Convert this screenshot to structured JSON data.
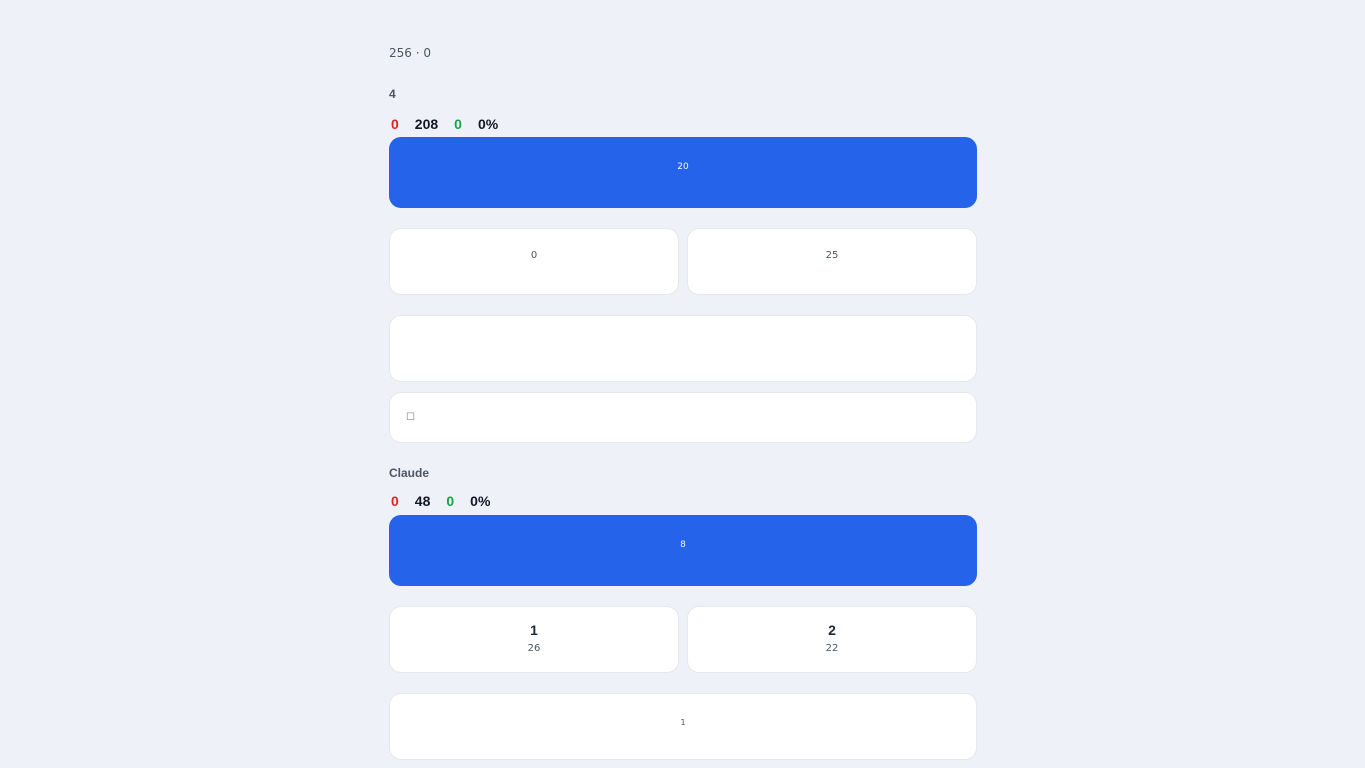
{
  "header": {
    "title": "",
    "subtitle": "256 · 0"
  },
  "section1": {
    "title_prefix": "",
    "title_count": "4",
    "stats": [
      {
        "value": "0",
        "label": "",
        "color": "#dc2626"
      },
      {
        "value": "208",
        "label": "",
        "color": "#111827"
      },
      {
        "value": "0",
        "label": "",
        "color": "#16a34a"
      },
      {
        "value": "0%",
        "label": "",
        "color": "#111827"
      }
    ],
    "primary": {
      "title": "",
      "subtitle": "20"
    },
    "cards": [
      {
        "title": "",
        "subtitle": "0"
      },
      {
        "title": "",
        "subtitle": "25"
      }
    ],
    "wide_card": {
      "title": "",
      "subtitle": ""
    },
    "search": {
      "icon": "search-icon",
      "placeholder": ""
    }
  },
  "section2": {
    "title_prefix": "",
    "title_brand": "Claude",
    "stats": [
      {
        "value": "0",
        "label": "",
        "color": "#dc2626"
      },
      {
        "value": "48",
        "label": "",
        "color": "#111827"
      },
      {
        "value": "0",
        "label": "",
        "color": "#16a34a"
      },
      {
        "value": "0%",
        "label": "",
        "color": "#111827"
      }
    ],
    "primary": {
      "title": "",
      "subtitle": "8"
    },
    "cards": [
      {
        "title_prefix": "",
        "title_num": "1",
        "subtitle": "26"
      },
      {
        "title_prefix": "",
        "title_num": "2",
        "subtitle": "22"
      }
    ],
    "wide_card": {
      "title": "",
      "subtitle": "1"
    }
  },
  "colors": {
    "accent": "#2563eb",
    "background": "#eef2f8",
    "danger": "#dc2626",
    "success": "#16a34a"
  }
}
